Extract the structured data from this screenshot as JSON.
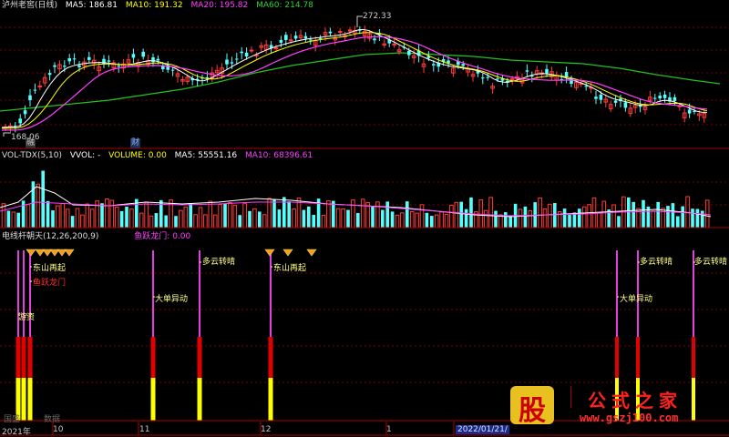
{
  "colors": {
    "up": "#ff3c3c",
    "down": "#54ffff",
    "ma5": "#ffffff",
    "ma10": "#ffff00",
    "ma20": "#ff40ff",
    "ma60": "#20c020",
    "grid": "#7a0000",
    "magenta": "#e040e0",
    "yellow_bar": "#ffff00",
    "red_bar": "#e00000"
  },
  "price_panel": {
    "stock_name": "泸州老窖(日线)",
    "ma5_label": "MA5: 186.81",
    "ma10_label": "MA10: 191.32",
    "ma20_label": "MA20: 195.82",
    "ma60_label": "MA60: 214.78",
    "high_marker": "272.33",
    "low_marker": "168.06",
    "event_tags": [
      "融",
      "财"
    ]
  },
  "volume_panel": {
    "title": "VOL-TDX(5,10)",
    "vvol": "VVOL: -",
    "volume": "VOLUME: 0.00",
    "ma5": "MA5: 55551.16",
    "ma10": "MA10: 68396.61"
  },
  "indicator_panel": {
    "title": "电线杆朝天(12,26,200,9)",
    "sub": "鱼跃龙门: 0.00",
    "annotations": [
      "东山再起",
      "鱼跃龙门",
      "游资",
      "大单异动",
      "多云转晴",
      "东山再起",
      "大单异动",
      "多云转晴",
      "多云转晴"
    ]
  },
  "date_axis": {
    "labels": [
      "2021年",
      "10",
      "11",
      "12",
      "1",
      "2022/01/21/"
    ]
  },
  "watermark": {
    "left_text": "国盛",
    "left_text2": "数据",
    "brand_char": "股",
    "brand_name": "公式之家",
    "url": "www.gszj100.com"
  }
}
